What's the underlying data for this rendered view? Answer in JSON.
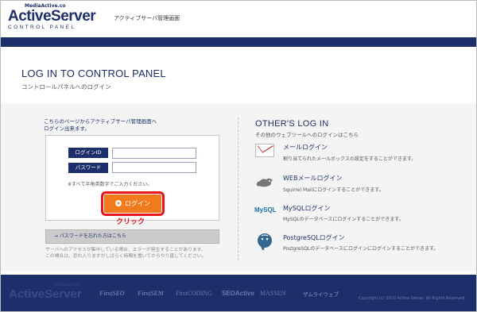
{
  "header": {
    "logo_small": "MediaActive.co",
    "logo": "ActiveServer",
    "logo_sub": "CONTROL PANEL",
    "title": "アクティブサーバ管理画面"
  },
  "page": {
    "title": "LOG IN TO CONTROL PANEL",
    "subtitle": "コントロールパネルへのログイン"
  },
  "login": {
    "intro_line1": "こちらのページからアクティブサーバ管理画面へ",
    "intro_line2": "ログイン出来ます。",
    "id_label": "ログインID",
    "password_label": "パスワード",
    "id_value": "",
    "password_value": "",
    "note": "※すべて半角英数字でご入力ください。",
    "button_label": "ログイン",
    "click_annotation": "クリック",
    "forgot_link": "→ パスワードを忘れた方はこちら",
    "warning_line1": "サーバへのアクセスが集中している場合、エラーが発生することがあります。",
    "warning_line2": "この場合は、恐れ入りますがしばらく時間を置いてからやり直してください。"
  },
  "others": {
    "title": "OTHER'S LOG IN",
    "subtitle": "その他のウェブツールへのログインはこちら",
    "services": [
      {
        "name": "メールログイン",
        "desc": "割り当てられたメールボックスの設定をすることができます。",
        "icon": "mail-icon"
      },
      {
        "name": "WEBメールログイン",
        "desc": "Squirrel Mailにログインすることができます。",
        "icon": "squirrel-icon"
      },
      {
        "name": "MySQLログイン",
        "desc": "MySQLのデータベースにログインすることができます。",
        "icon": "mysql-icon"
      },
      {
        "name": "PostgreSQLログイン",
        "desc": "PostgreSQLのデータベースにログインにログインすることができます。",
        "icon": "postgresql-icon"
      }
    ],
    "mysql_icon_text": "MySQL"
  },
  "footer": {
    "logo": "ActiveServer",
    "logo_small": "MediaActive",
    "brands": [
      "FirstSEO",
      "FirstSEM",
      "FirstCODING",
      "SEOActive",
      "MASSEN",
      "ザムライウェブ"
    ],
    "copyright": "Copyright (c) 2010 Active Server. All Rights Reserved."
  },
  "colors": {
    "navy": "#1d2f6a",
    "orange": "#f07a1c",
    "red": "#e8141c"
  }
}
